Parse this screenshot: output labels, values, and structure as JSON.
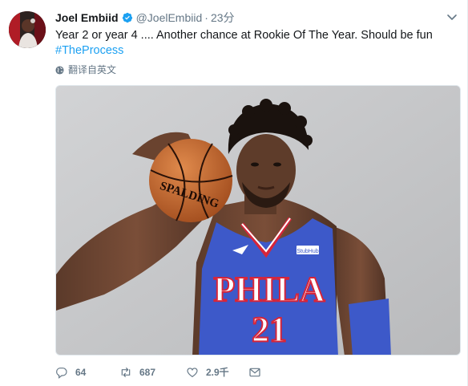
{
  "tweet": {
    "author": {
      "name": "Joel Embiid",
      "handle": "@JoelEmbiid",
      "verified": true
    },
    "time": "23分",
    "separator": "·",
    "text": "Year 2 or year 4 .... Another chance at Rookie Of The Year. Should be fun",
    "hashtag": "#TheProcess",
    "translate_label": "翻译自英文",
    "media": {
      "ball_brand": "SPALDING",
      "jersey_text": "PHILA",
      "jersey_number": "21",
      "patch_text": "StubHub"
    },
    "actions": {
      "reply_count": "64",
      "retweet_count": "687",
      "like_count": "2.9千"
    }
  },
  "colors": {
    "link": "#1da1f2",
    "secondary": "#657786",
    "primary_text": "#14171a",
    "jersey_blue": "#3d59c9",
    "jersey_red": "#d6253a",
    "background_gray": "#c5c6c8"
  },
  "icons": [
    "verified-badge-icon",
    "chevron-down-icon",
    "globe-icon",
    "reply-icon",
    "retweet-icon",
    "like-icon",
    "direct-message-icon"
  ]
}
